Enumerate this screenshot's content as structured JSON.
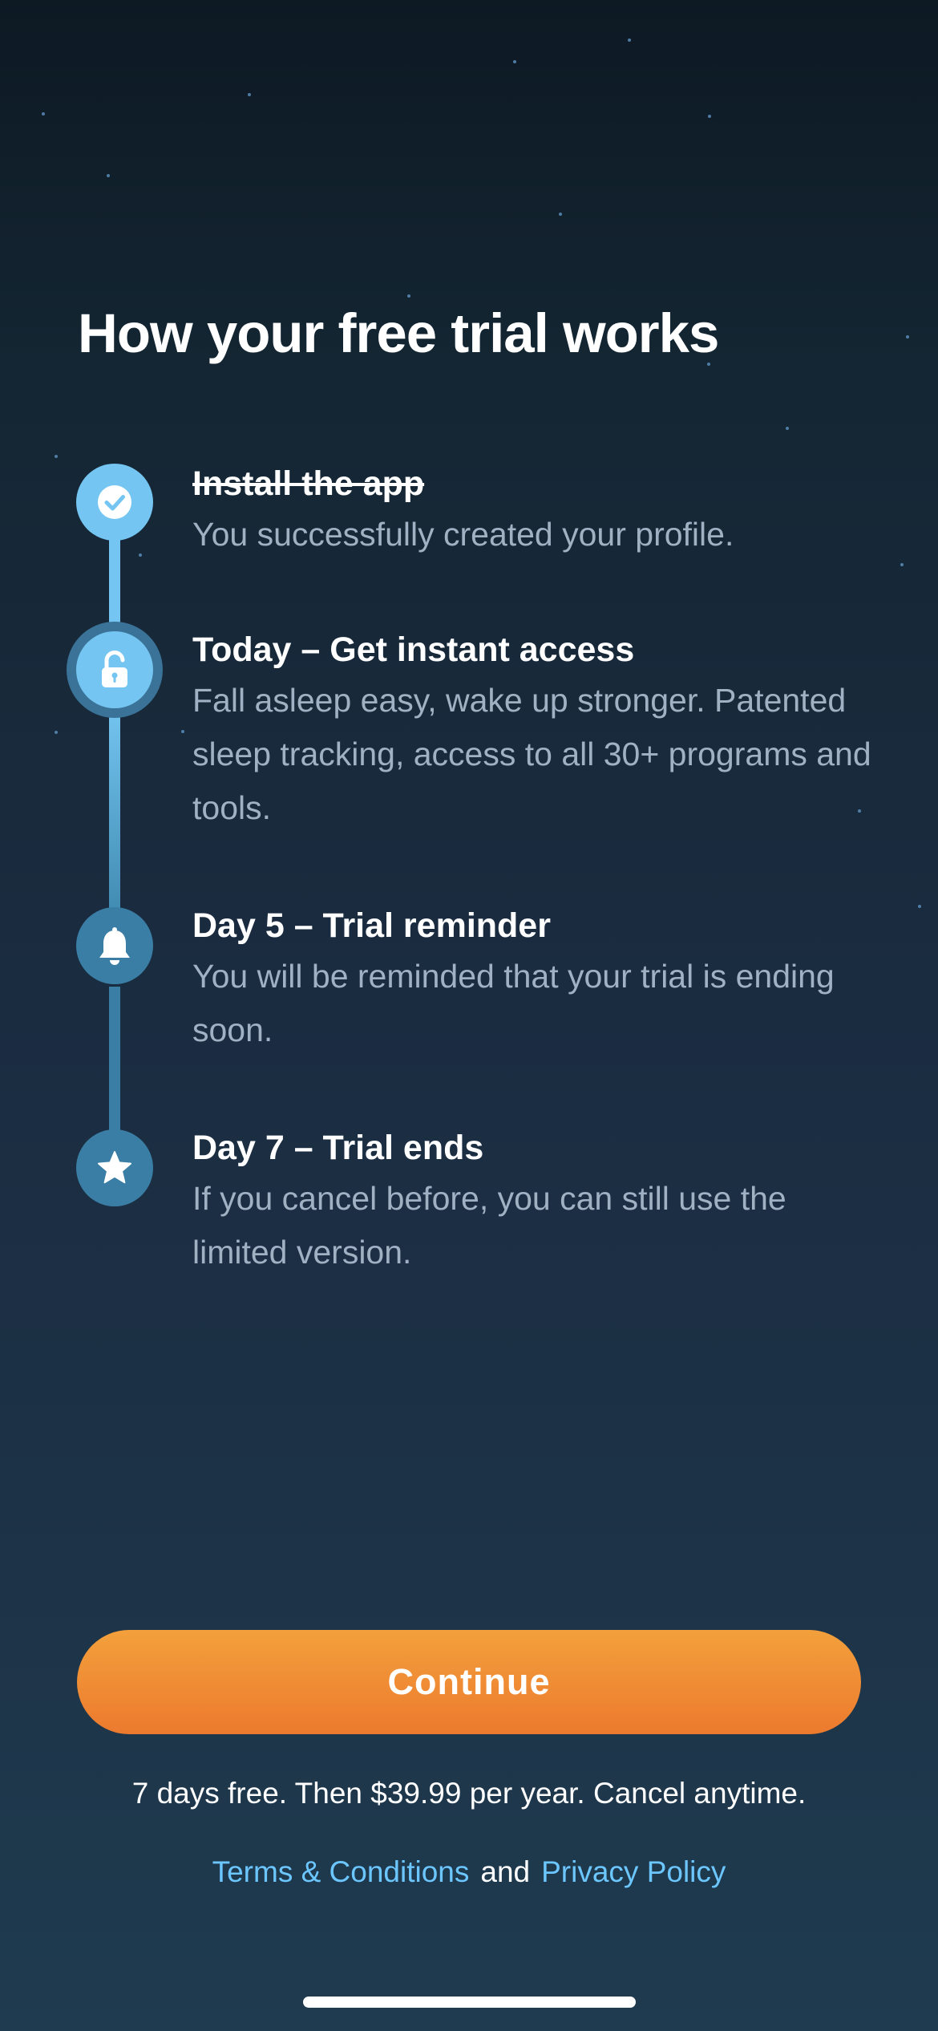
{
  "title": "How your free trial works",
  "steps": [
    {
      "icon": "check-icon",
      "title": "Install the app",
      "desc": "You successfully created your profile."
    },
    {
      "icon": "unlock-icon",
      "title": "Today – Get instant access",
      "desc": "Fall asleep easy, wake up stronger. Patented sleep tracking, access to all 30+ programs and tools."
    },
    {
      "icon": "bell-icon",
      "title": "Day 5 – Trial reminder",
      "desc": "You will be reminded that your trial is ending soon."
    },
    {
      "icon": "star-icon",
      "title": "Day 7 – Trial ends",
      "desc": "If you cancel before, you can still use the limited version."
    }
  ],
  "continue_label": "Continue",
  "price_note": "7 days free. Then $39.99 per year. Cancel anytime.",
  "legal": {
    "terms": "Terms & Conditions",
    "and": "and",
    "privacy": "Privacy Policy"
  },
  "colors": {
    "accent_orange": "#ef8a33",
    "timeline_active": "#74c5f1",
    "timeline_inactive": "#3a7ea5",
    "link": "#6cc6ff"
  }
}
